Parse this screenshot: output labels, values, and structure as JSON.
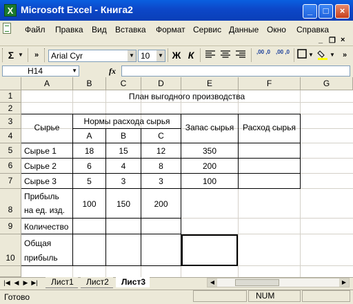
{
  "window": {
    "title": "Microsoft Excel - Книга2",
    "app_icon": "excel-x-icon",
    "buttons": {
      "minimize": "_",
      "maximize": "□",
      "close": "×"
    }
  },
  "menu": {
    "items": [
      "Файл",
      "Правка",
      "Вид",
      "Вставка",
      "Формат",
      "Сервис",
      "Данные",
      "Окно",
      "Справка"
    ],
    "doc_controls": {
      "minimize": "_",
      "restore": "❐",
      "close": "×"
    }
  },
  "toolbar": {
    "font_name": "Arial Cyr",
    "font_size": "10",
    "bold": "Ж",
    "italic": "К",
    "autosum": "Σ",
    "increase_decimal": ",00 ,0",
    "decrease_decimal": ",00 ,0"
  },
  "formula_bar": {
    "name_box": "H14",
    "fx": "fx",
    "formula": ""
  },
  "grid": {
    "columns": [
      "A",
      "B",
      "C",
      "D",
      "E",
      "F",
      "G"
    ],
    "rows": [
      "1",
      "2",
      "3",
      "4",
      "5",
      "6",
      "7",
      "8",
      "9",
      "10"
    ],
    "cells": {
      "title": "План выгодного производства",
      "raw": "Сырье",
      "norms": "Нормы расхода сырья",
      "prod_a": "A",
      "prod_b": "B",
      "prod_c": "C",
      "stock": "Запас сырья",
      "consumption": "Расход сырья",
      "r5": {
        "label": "Сырье 1",
        "a": "18",
        "b": "15",
        "c": "12",
        "stock": "350"
      },
      "r6": {
        "label": "Сырье 2",
        "a": "6",
        "b": "4",
        "c": "8",
        "stock": "200"
      },
      "r7": {
        "label": "Сырье 3",
        "a": "5",
        "b": "3",
        "c": "3",
        "stock": "100"
      },
      "r8": {
        "label_line1": "Прибыль",
        "label_line2": "на ед. изд.",
        "a": "100",
        "b": "150",
        "c": "200"
      },
      "r9": {
        "label": "Количество"
      },
      "r10": {
        "label_line1": "Общая",
        "label_line2": "прибыль"
      }
    }
  },
  "sheets": {
    "tabs": [
      "Лист1",
      "Лист2",
      "Лист3"
    ],
    "active": "Лист3"
  },
  "status": {
    "text": "Готово",
    "num": "NUM"
  }
}
